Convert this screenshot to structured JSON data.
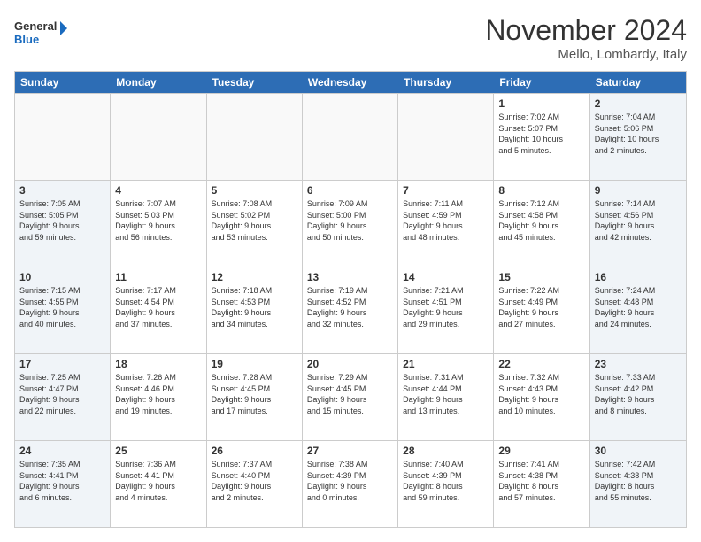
{
  "logo": {
    "line1": "General",
    "line2": "Blue"
  },
  "title": "November 2024",
  "location": "Mello, Lombardy, Italy",
  "days": [
    "Sunday",
    "Monday",
    "Tuesday",
    "Wednesday",
    "Thursday",
    "Friday",
    "Saturday"
  ],
  "weeks": [
    [
      {
        "day": "",
        "info": ""
      },
      {
        "day": "",
        "info": ""
      },
      {
        "day": "",
        "info": ""
      },
      {
        "day": "",
        "info": ""
      },
      {
        "day": "",
        "info": ""
      },
      {
        "day": "1",
        "info": "Sunrise: 7:02 AM\nSunset: 5:07 PM\nDaylight: 10 hours\nand 5 minutes."
      },
      {
        "day": "2",
        "info": "Sunrise: 7:04 AM\nSunset: 5:06 PM\nDaylight: 10 hours\nand 2 minutes."
      }
    ],
    [
      {
        "day": "3",
        "info": "Sunrise: 7:05 AM\nSunset: 5:05 PM\nDaylight: 9 hours\nand 59 minutes."
      },
      {
        "day": "4",
        "info": "Sunrise: 7:07 AM\nSunset: 5:03 PM\nDaylight: 9 hours\nand 56 minutes."
      },
      {
        "day": "5",
        "info": "Sunrise: 7:08 AM\nSunset: 5:02 PM\nDaylight: 9 hours\nand 53 minutes."
      },
      {
        "day": "6",
        "info": "Sunrise: 7:09 AM\nSunset: 5:00 PM\nDaylight: 9 hours\nand 50 minutes."
      },
      {
        "day": "7",
        "info": "Sunrise: 7:11 AM\nSunset: 4:59 PM\nDaylight: 9 hours\nand 48 minutes."
      },
      {
        "day": "8",
        "info": "Sunrise: 7:12 AM\nSunset: 4:58 PM\nDaylight: 9 hours\nand 45 minutes."
      },
      {
        "day": "9",
        "info": "Sunrise: 7:14 AM\nSunset: 4:56 PM\nDaylight: 9 hours\nand 42 minutes."
      }
    ],
    [
      {
        "day": "10",
        "info": "Sunrise: 7:15 AM\nSunset: 4:55 PM\nDaylight: 9 hours\nand 40 minutes."
      },
      {
        "day": "11",
        "info": "Sunrise: 7:17 AM\nSunset: 4:54 PM\nDaylight: 9 hours\nand 37 minutes."
      },
      {
        "day": "12",
        "info": "Sunrise: 7:18 AM\nSunset: 4:53 PM\nDaylight: 9 hours\nand 34 minutes."
      },
      {
        "day": "13",
        "info": "Sunrise: 7:19 AM\nSunset: 4:52 PM\nDaylight: 9 hours\nand 32 minutes."
      },
      {
        "day": "14",
        "info": "Sunrise: 7:21 AM\nSunset: 4:51 PM\nDaylight: 9 hours\nand 29 minutes."
      },
      {
        "day": "15",
        "info": "Sunrise: 7:22 AM\nSunset: 4:49 PM\nDaylight: 9 hours\nand 27 minutes."
      },
      {
        "day": "16",
        "info": "Sunrise: 7:24 AM\nSunset: 4:48 PM\nDaylight: 9 hours\nand 24 minutes."
      }
    ],
    [
      {
        "day": "17",
        "info": "Sunrise: 7:25 AM\nSunset: 4:47 PM\nDaylight: 9 hours\nand 22 minutes."
      },
      {
        "day": "18",
        "info": "Sunrise: 7:26 AM\nSunset: 4:46 PM\nDaylight: 9 hours\nand 19 minutes."
      },
      {
        "day": "19",
        "info": "Sunrise: 7:28 AM\nSunset: 4:45 PM\nDaylight: 9 hours\nand 17 minutes."
      },
      {
        "day": "20",
        "info": "Sunrise: 7:29 AM\nSunset: 4:45 PM\nDaylight: 9 hours\nand 15 minutes."
      },
      {
        "day": "21",
        "info": "Sunrise: 7:31 AM\nSunset: 4:44 PM\nDaylight: 9 hours\nand 13 minutes."
      },
      {
        "day": "22",
        "info": "Sunrise: 7:32 AM\nSunset: 4:43 PM\nDaylight: 9 hours\nand 10 minutes."
      },
      {
        "day": "23",
        "info": "Sunrise: 7:33 AM\nSunset: 4:42 PM\nDaylight: 9 hours\nand 8 minutes."
      }
    ],
    [
      {
        "day": "24",
        "info": "Sunrise: 7:35 AM\nSunset: 4:41 PM\nDaylight: 9 hours\nand 6 minutes."
      },
      {
        "day": "25",
        "info": "Sunrise: 7:36 AM\nSunset: 4:41 PM\nDaylight: 9 hours\nand 4 minutes."
      },
      {
        "day": "26",
        "info": "Sunrise: 7:37 AM\nSunset: 4:40 PM\nDaylight: 9 hours\nand 2 minutes."
      },
      {
        "day": "27",
        "info": "Sunrise: 7:38 AM\nSunset: 4:39 PM\nDaylight: 9 hours\nand 0 minutes."
      },
      {
        "day": "28",
        "info": "Sunrise: 7:40 AM\nSunset: 4:39 PM\nDaylight: 8 hours\nand 59 minutes."
      },
      {
        "day": "29",
        "info": "Sunrise: 7:41 AM\nSunset: 4:38 PM\nDaylight: 8 hours\nand 57 minutes."
      },
      {
        "day": "30",
        "info": "Sunrise: 7:42 AM\nSunset: 4:38 PM\nDaylight: 8 hours\nand 55 minutes."
      }
    ]
  ]
}
